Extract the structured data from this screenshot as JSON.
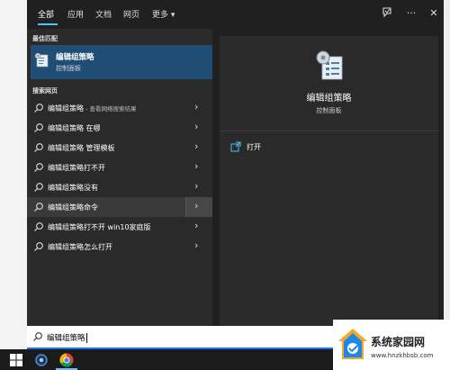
{
  "tabs": [
    {
      "label": "全部"
    },
    {
      "label": "应用"
    },
    {
      "label": "文档"
    },
    {
      "label": "网页"
    },
    {
      "label": "更多 ▾"
    }
  ],
  "toolbar": {
    "feedback_icon": "feedback-icon",
    "more_label": "···",
    "close_label": "✕"
  },
  "best_match": {
    "section": "最佳匹配",
    "title": "编辑组策略",
    "subtitle": "控制面板"
  },
  "web_section": "搜索网页",
  "web_results": [
    {
      "text": "编辑组策略",
      "sub": " - 查看网络搜索结果"
    },
    {
      "text": "编辑组策略 在哪",
      "sub": ""
    },
    {
      "text": "编辑组策略 管理模板",
      "sub": ""
    },
    {
      "text": "编辑组策略打不开",
      "sub": ""
    },
    {
      "text": "编辑组策略没有",
      "sub": ""
    },
    {
      "text": "编辑组策略命令",
      "sub": ""
    },
    {
      "text": "编辑组策略打不开 win10家庭版",
      "sub": ""
    },
    {
      "text": "编辑组策略怎么打开",
      "sub": ""
    }
  ],
  "detail": {
    "title": "编辑组策略",
    "subtitle": "控制面板",
    "open_label": "打开"
  },
  "search": {
    "value": "编辑组策略"
  },
  "watermark": {
    "line1": "系统家园网",
    "line2": "www.hnzkhbsb.com"
  },
  "colors": {
    "accent": "#4cc2ff",
    "best_match_bg": "#1f4d73",
    "panel_bg": "#2a2a2a"
  }
}
